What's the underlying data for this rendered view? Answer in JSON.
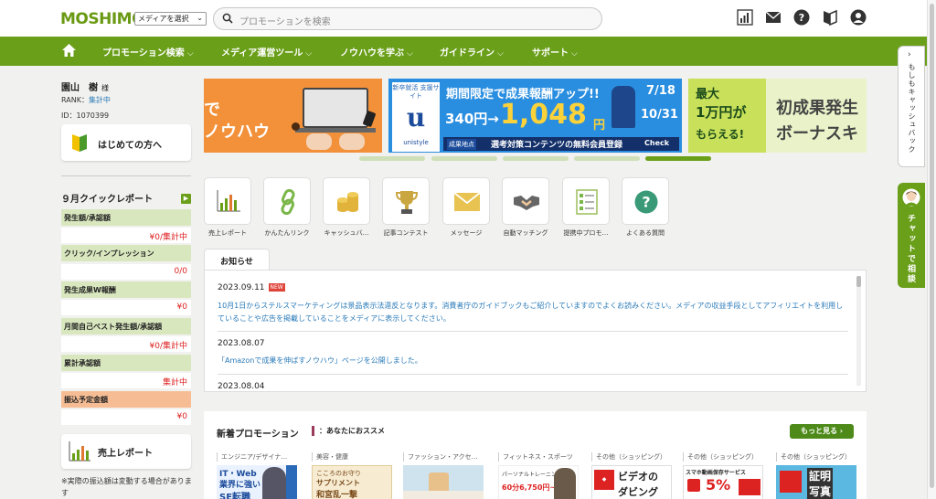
{
  "header": {
    "logo": "MOSHIMO",
    "media_select": "メディアを選択",
    "search_placeholder": "プロモーションを検索"
  },
  "nav": {
    "items": [
      {
        "label": "プロモーション検索"
      },
      {
        "label": "メディア運営ツール"
      },
      {
        "label": "ノウハウを学ぶ"
      },
      {
        "label": "ガイドライン"
      },
      {
        "label": "サポート"
      }
    ]
  },
  "user": {
    "name": "園山　樹",
    "honorific": "様",
    "rank_label": "RANK：",
    "rank_value": "集計中",
    "id_text": "ID：1070399"
  },
  "sidebar": {
    "beginner_label": "はじめての方へ",
    "quick_report_title": "９月クイックレポート",
    "report_rows": [
      {
        "label": "発生額/承認額",
        "value": "¥0/集計中"
      },
      {
        "label": "クリック/インプレッション",
        "value": "0/0"
      },
      {
        "label": "発生成果W報酬",
        "value": "¥0"
      },
      {
        "label": "月間自己ベスト発生額/承認額",
        "value": "¥0/集計中"
      },
      {
        "label": "累計承認額",
        "value": "集計中"
      },
      {
        "label": "振込予定金額",
        "value": "¥0"
      }
    ],
    "sales_report_label": "売上レポート",
    "note": "※実際の振込額は変動する場合があります"
  },
  "banners": {
    "b1": {
      "text1": "で",
      "text2": "ノウハウ"
    },
    "b2": {
      "badge": "新卒就活 支援サイト",
      "brand": "unistyle",
      "headline": "期間限定で成果報酬アップ!!",
      "from": "340円→",
      "to": "1,048",
      "yen": "円",
      "date1": "7/18",
      "date2": "10/31",
      "point_label": "成果地点",
      "point_text": "選考対策コンテンツの無料会員登録",
      "check": "Check"
    },
    "b3": {
      "text1": "最大",
      "text2": "1万円が",
      "text3": "もらえる!",
      "text4": "初成果発生",
      "text5": "ボーナスキ"
    }
  },
  "tiles": [
    {
      "label": "売上レポート"
    },
    {
      "label": "かんたんリンク"
    },
    {
      "label": "キャッシュバ…"
    },
    {
      "label": "記事コンテスト"
    },
    {
      "label": "メッセージ"
    },
    {
      "label": "自動マッチング"
    },
    {
      "label": "提携中プロモ…"
    },
    {
      "label": "よくある質問"
    }
  ],
  "news": {
    "tab": "お知らせ",
    "items": [
      {
        "date": "2023.09.11",
        "new": "NEW",
        "text": "10月1日からステルスマーケティングは景品表示法違反となります。消費者庁のガイドブックもご紹介していますのでよくお読みください。メディアの収益手段としてアフィリエイトを利用していることや広告を掲載していることをメディアに表示してください。"
      },
      {
        "date": "2023.08.07",
        "text": "「Amazonで成果を伸ばすノウハウ」ページを公開しました。"
      },
      {
        "date": "2023.08.04",
        "text": ""
      }
    ]
  },
  "promotions": {
    "title": "新着プロモーション",
    "recommend": "：あなたにおススメ",
    "more": "もっと見る",
    "categories": [
      "エンジニア/デザイナ…",
      "美容・健康",
      "ファッション・アクセ…",
      "フィットネス・スポーツ",
      "その他（ショッピング）",
      "その他（ショッピング）",
      "その他（ショッピング）"
    ],
    "thumbs": [
      {
        "t1": "IT・Web",
        "t2": "業界に強い",
        "t3": "SE転職"
      },
      {
        "t1": "こころのお守り",
        "t2": "サプリメント",
        "t3": "和宮乱一撃"
      },
      {
        "t1": ""
      },
      {
        "t1": "パーソナルトレーニング",
        "t2": "60分6,750円~"
      },
      {
        "t1": "ビデオの",
        "t2": "ダビング"
      },
      {
        "t1": "スマホ動画保存サービス",
        "t2": "5%"
      },
      {
        "t1": "証明",
        "t2": "写真"
      }
    ]
  },
  "right_tabs": {
    "cashback": "もしもキャッシュバック",
    "chat": "チャットで相談"
  },
  "colors": {
    "brand_green": "#6a9f1a",
    "link_blue": "#2a7ab8",
    "alert_red": "#d22222"
  }
}
